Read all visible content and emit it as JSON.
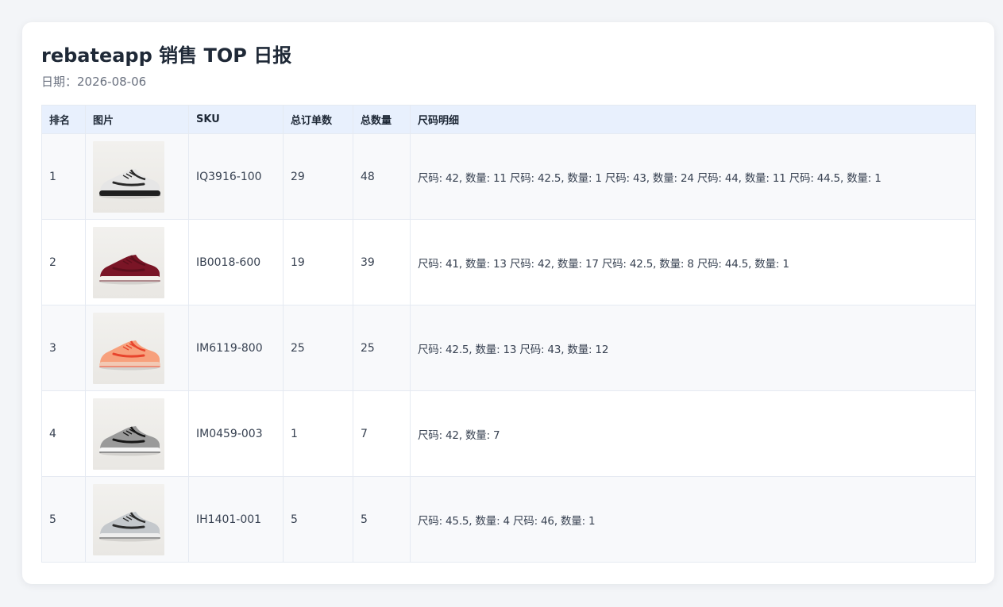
{
  "report": {
    "title": "rebateapp 销售 TOP 日报",
    "date_label": "日期：2026-08-06"
  },
  "table": {
    "headers": {
      "rank": "排名",
      "image": "图片",
      "sku": "SKU",
      "orders": "总订单数",
      "quantity": "总数量",
      "sizes": "尺码明细"
    },
    "rows": [
      {
        "rank": "1",
        "image_alt": "sneaker white and black",
        "sku": "IQ3916-100",
        "orders": "29",
        "quantity": "48",
        "sizes": "尺码: 42, 数量: 11 尺码: 42.5, 数量: 1 尺码: 43, 数量: 24 尺码: 44, 数量: 11 尺码: 44.5, 数量: 1",
        "shoe_upper": "#e6e6e6",
        "shoe_sole": "#1f1f1f",
        "shoe_accent": "#2a2a2a"
      },
      {
        "rank": "2",
        "image_alt": "sneaker burgundy",
        "sku": "IB0018-600",
        "orders": "19",
        "quantity": "39",
        "sizes": "尺码: 41, 数量: 13 尺码: 42, 数量: 17 尺码: 42.5, 数量: 8 尺码: 44.5, 数量: 1",
        "shoe_upper": "#7a1526",
        "shoe_sole": "#f4f1ec",
        "shoe_accent": "#5e0f1c"
      },
      {
        "rank": "3",
        "image_alt": "sneaker orange",
        "sku": "IM6119-800",
        "orders": "25",
        "quantity": "25",
        "sizes": "尺码: 42.5, 数量: 13 尺码: 43, 数量: 12",
        "shoe_upper": "#f7a07c",
        "shoe_sole": "#f2c9b4",
        "shoe_accent": "#e8442c"
      },
      {
        "rank": "4",
        "image_alt": "sneaker grey black",
        "sku": "IM0459-003",
        "orders": "1",
        "quantity": "7",
        "sizes": "尺码: 42, 数量: 7",
        "shoe_upper": "#9a9a9a",
        "shoe_sole": "#f6f6f6",
        "shoe_accent": "#161616"
      },
      {
        "rank": "5",
        "image_alt": "sneaker grey",
        "sku": "IH1401-001",
        "orders": "5",
        "quantity": "5",
        "sizes": "尺码: 45.5, 数量: 4 尺码: 46, 数量: 1",
        "shoe_upper": "#c4c8cc",
        "shoe_sole": "#eeeeee",
        "shoe_accent": "#2b2b2b"
      }
    ]
  }
}
